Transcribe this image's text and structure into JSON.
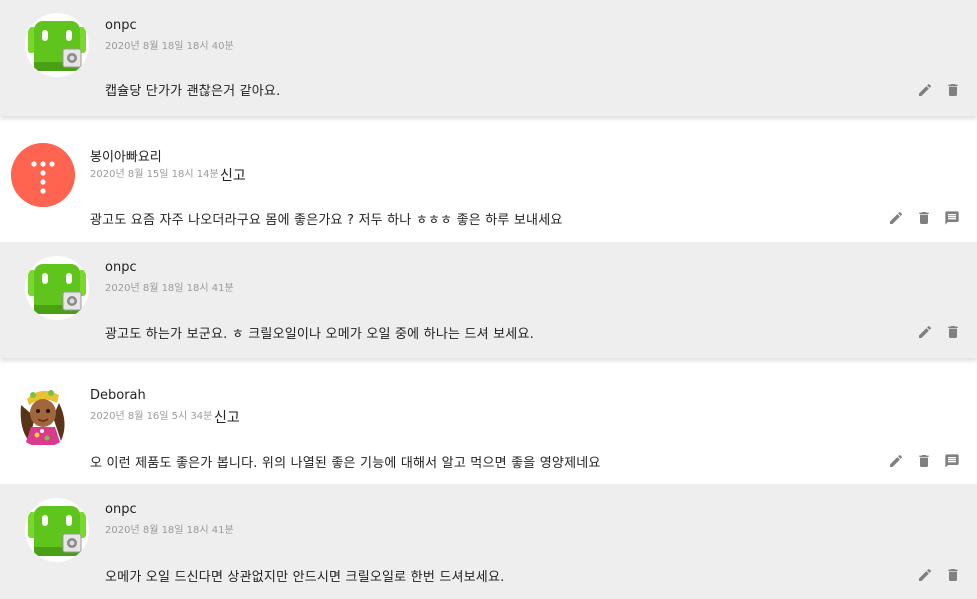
{
  "items": [
    {
      "kind": "reply",
      "author": "onpc",
      "date": "2020년 8월 18일 18시 40분",
      "text": "캡슐당 단가가 괜찮은거 같아요.",
      "actions": [
        "edit-icon",
        "delete-icon"
      ]
    },
    {
      "kind": "comment",
      "author": "봉이아빠요리",
      "date": "2020년 8월 15일 18시 14분",
      "report_label": "신고",
      "text": "광고도 요즘 자주 나오더라구요 몸에 좋은가요 ? 저두 하나 ㅎㅎㅎ 좋은 하루 보내세요",
      "actions": [
        "edit-icon",
        "delete-icon",
        "reply-icon"
      ]
    },
    {
      "kind": "reply",
      "author": "onpc",
      "date": "2020년 8월 18일 18시 41분",
      "text": "광고도 하는가 보군요. ㅎ 크릴오일이나 오메가 오일 중에 하나는 드셔 보세요.",
      "actions": [
        "edit-icon",
        "delete-icon"
      ]
    },
    {
      "kind": "comment",
      "author": "Deborah",
      "date": "2020년 8월 16일 5시 34분",
      "report_label": "신고",
      "text": "오 이런 제품도 좋은가 봅니다. 위의 나열된 좋은 기능에 대해서 알고 먹으면 좋을 영양제네요",
      "actions": [
        "edit-icon",
        "delete-icon",
        "reply-icon"
      ]
    },
    {
      "kind": "reply",
      "author": "onpc",
      "date": "2020년 8월 18일 18시 41분",
      "text": "오메가 오일 드신다면 상관없지만 안드시면 크릴오일로 한번 드셔보세요.",
      "actions": [
        "edit-icon",
        "delete-icon"
      ]
    }
  ],
  "colors": {
    "reply_bg": "#eeeeee",
    "comment_bg": "#ffffff",
    "icon": "#808080",
    "meta": "#9a9a9a",
    "avatar_green": "#5fc41c",
    "avatar_coral": "#ff6450"
  }
}
